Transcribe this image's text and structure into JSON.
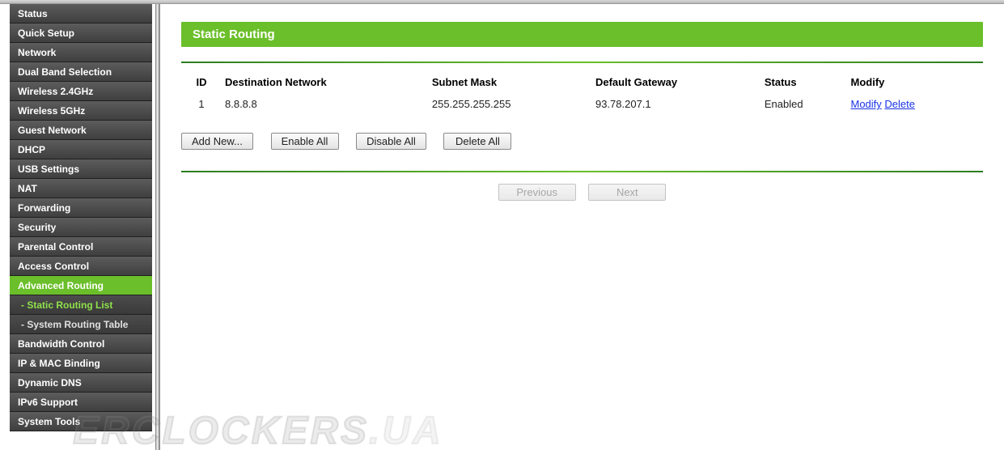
{
  "sidebar": {
    "items": [
      {
        "label": "Status"
      },
      {
        "label": "Quick Setup"
      },
      {
        "label": "Network"
      },
      {
        "label": "Dual Band Selection"
      },
      {
        "label": "Wireless 2.4GHz"
      },
      {
        "label": "Wireless 5GHz"
      },
      {
        "label": "Guest Network"
      },
      {
        "label": "DHCP"
      },
      {
        "label": "USB Settings"
      },
      {
        "label": "NAT"
      },
      {
        "label": "Forwarding"
      },
      {
        "label": "Security"
      },
      {
        "label": "Parental Control"
      },
      {
        "label": "Access Control"
      },
      {
        "label": "Advanced Routing",
        "active": true,
        "subs": [
          {
            "label": "- Static Routing List",
            "current": true
          },
          {
            "label": "- System Routing Table"
          }
        ]
      },
      {
        "label": "Bandwidth Control"
      },
      {
        "label": "IP & MAC Binding"
      },
      {
        "label": "Dynamic DNS"
      },
      {
        "label": "IPv6 Support"
      },
      {
        "label": "System Tools"
      }
    ]
  },
  "page": {
    "title": "Static Routing"
  },
  "table": {
    "headers": {
      "id": "ID",
      "dest": "Destination Network",
      "mask": "Subnet Mask",
      "gw": "Default Gateway",
      "status": "Status",
      "modify": "Modify"
    },
    "rows": [
      {
        "id": "1",
        "dest": "8.8.8.8",
        "mask": "255.255.255.255",
        "gw": "93.78.207.1",
        "status": "Enabled"
      }
    ]
  },
  "actions": {
    "add": "Add New...",
    "enable_all": "Enable All",
    "disable_all": "Disable All",
    "delete_all": "Delete All",
    "modify": "Modify",
    "delete": "Delete"
  },
  "pager": {
    "prev": "Previous",
    "next": "Next"
  },
  "watermark": {
    "main": "ERCLOCKERS",
    "suffix": ".UA"
  }
}
